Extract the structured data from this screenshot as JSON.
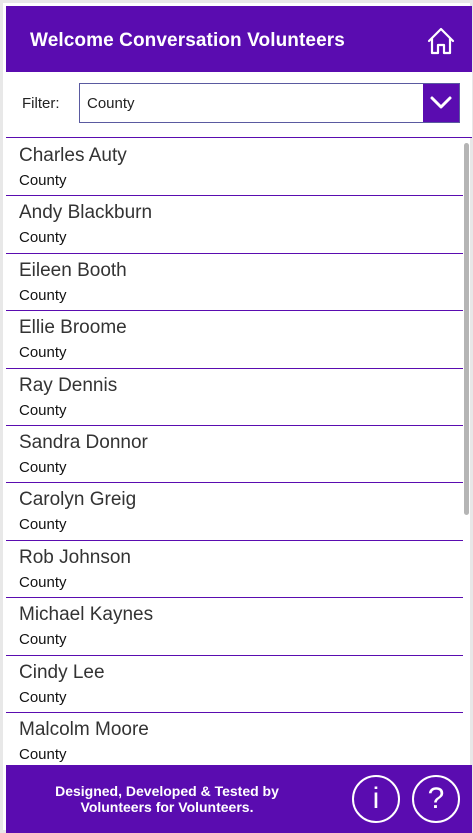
{
  "header": {
    "title": "Welcome Conversation Volunteers",
    "home_icon": "home-icon"
  },
  "filter": {
    "label": "Filter:",
    "selected": "County",
    "chevron_icon": "chevron-down-icon"
  },
  "volunteers": [
    {
      "name": "Charles Auty",
      "area": "County"
    },
    {
      "name": "Andy Blackburn",
      "area": "County"
    },
    {
      "name": "Eileen Booth",
      "area": "County"
    },
    {
      "name": "Ellie Broome",
      "area": "County"
    },
    {
      "name": "Ray Dennis",
      "area": "County"
    },
    {
      "name": "Sandra Donnor",
      "area": "County"
    },
    {
      "name": "Carolyn Greig",
      "area": "County"
    },
    {
      "name": "Rob Johnson",
      "area": "County"
    },
    {
      "name": "Michael Kaynes",
      "area": "County"
    },
    {
      "name": "Cindy Lee",
      "area": "County"
    },
    {
      "name": "Malcolm Moore",
      "area": "County"
    }
  ],
  "footer": {
    "line1": "Designed, Developed & Tested by",
    "line2": "Volunteers for Volunteers.",
    "info_label": "i",
    "help_label": "?"
  },
  "colors": {
    "brand_purple": "#5a0cb0",
    "text_dark": "#333333"
  }
}
